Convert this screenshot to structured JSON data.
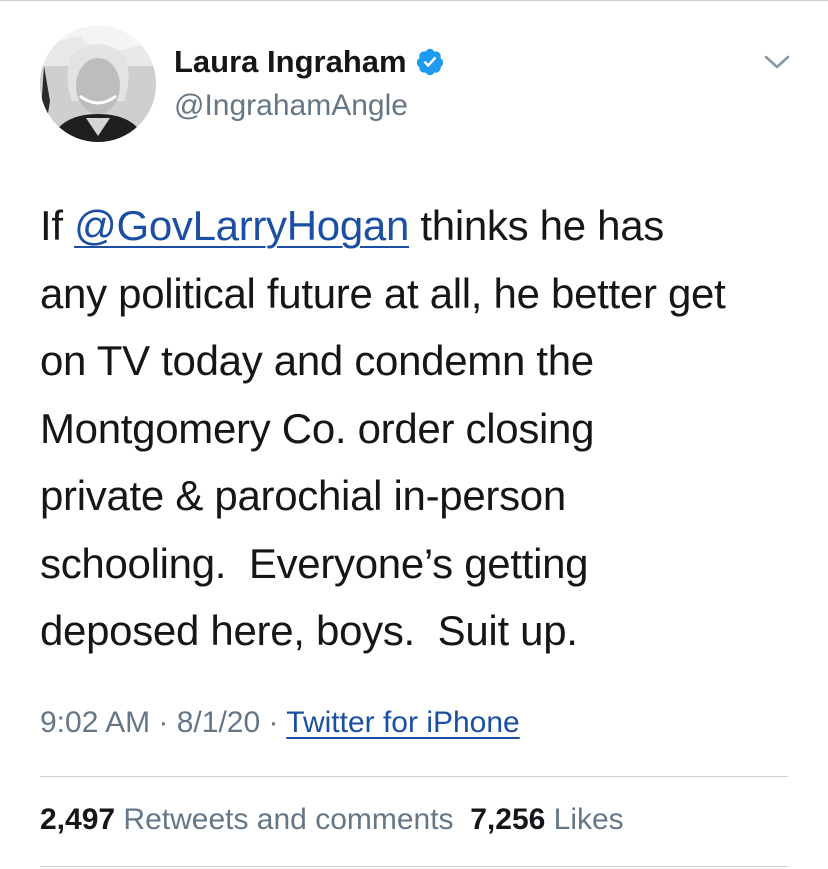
{
  "user": {
    "display_name": "Laura Ingraham",
    "handle": "@IngrahamAngle",
    "verified_icon": "verified-badge-icon",
    "avatar_icon": "profile-photo"
  },
  "tweet": {
    "line1_pre": "If ",
    "mention": "@GovLarryHogan",
    "line1_post": " thinks he has",
    "line2": "any political future at all, he better get",
    "line3": "on TV today and condemn the",
    "line4": "Montgomery Co. order closing",
    "line5": "private & parochial in-person",
    "line6": "schooling.  Everyone’s getting",
    "line7": "deposed here, boys.  Suit up."
  },
  "meta": {
    "time": "9:02 AM",
    "sep1": " · ",
    "date": "8/1/20",
    "sep2": " · ",
    "source": "Twitter for iPhone"
  },
  "stats": {
    "retweets_count": "2,497",
    "retweets_label": " Retweets and comments",
    "likes_count": "7,256",
    "likes_label": " Likes"
  },
  "colors": {
    "link": "#1b4fa3",
    "verified": "#1d9bf0",
    "secondary_text": "#657786"
  }
}
